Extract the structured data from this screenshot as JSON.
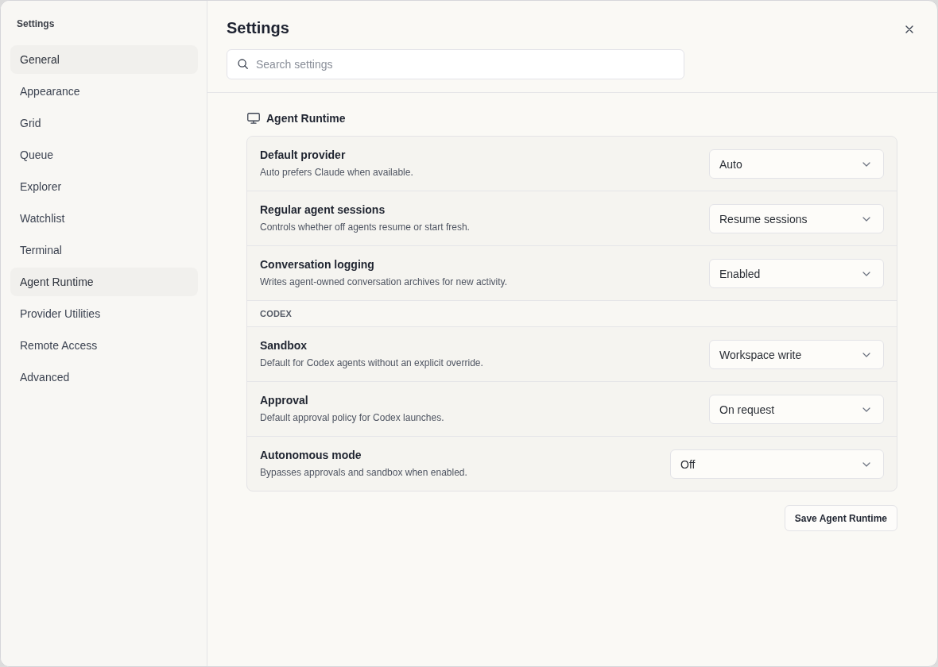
{
  "sidebar": {
    "title": "Settings",
    "items": [
      {
        "label": "General",
        "selected": true
      },
      {
        "label": "Appearance",
        "selected": false
      },
      {
        "label": "Grid",
        "selected": false
      },
      {
        "label": "Queue",
        "selected": false
      },
      {
        "label": "Explorer",
        "selected": false
      },
      {
        "label": "Watchlist",
        "selected": false
      },
      {
        "label": "Terminal",
        "selected": false
      },
      {
        "label": "Agent Runtime",
        "selected": true
      },
      {
        "label": "Provider Utilities",
        "selected": false
      },
      {
        "label": "Remote Access",
        "selected": false
      },
      {
        "label": "Advanced",
        "selected": false
      }
    ]
  },
  "header": {
    "title": "Settings",
    "search": {
      "placeholder": "Search settings"
    }
  },
  "section": {
    "title": "Agent Runtime",
    "rows": [
      {
        "kind": "setting",
        "title": "Default provider",
        "description": "Auto prefers Claude when available.",
        "value": "Auto"
      },
      {
        "kind": "setting",
        "title": "Regular agent sessions",
        "description": "Controls whether off agents resume or start fresh.",
        "value": "Resume sessions"
      },
      {
        "kind": "setting",
        "title": "Conversation logging",
        "description": "Writes agent-owned conversation archives for new activity.",
        "value": "Enabled"
      },
      {
        "kind": "group",
        "label": "CODEX"
      },
      {
        "kind": "setting",
        "title": "Sandbox",
        "description": "Default for Codex agents without an explicit override.",
        "value": "Workspace write"
      },
      {
        "kind": "setting",
        "title": "Approval",
        "description": "Default approval policy for Codex launches.",
        "value": "On request"
      },
      {
        "kind": "setting",
        "title": "Autonomous mode",
        "description": "Bypasses approvals and sandbox when enabled.",
        "value": "Off"
      }
    ],
    "save_button": "Save Agent Runtime"
  }
}
